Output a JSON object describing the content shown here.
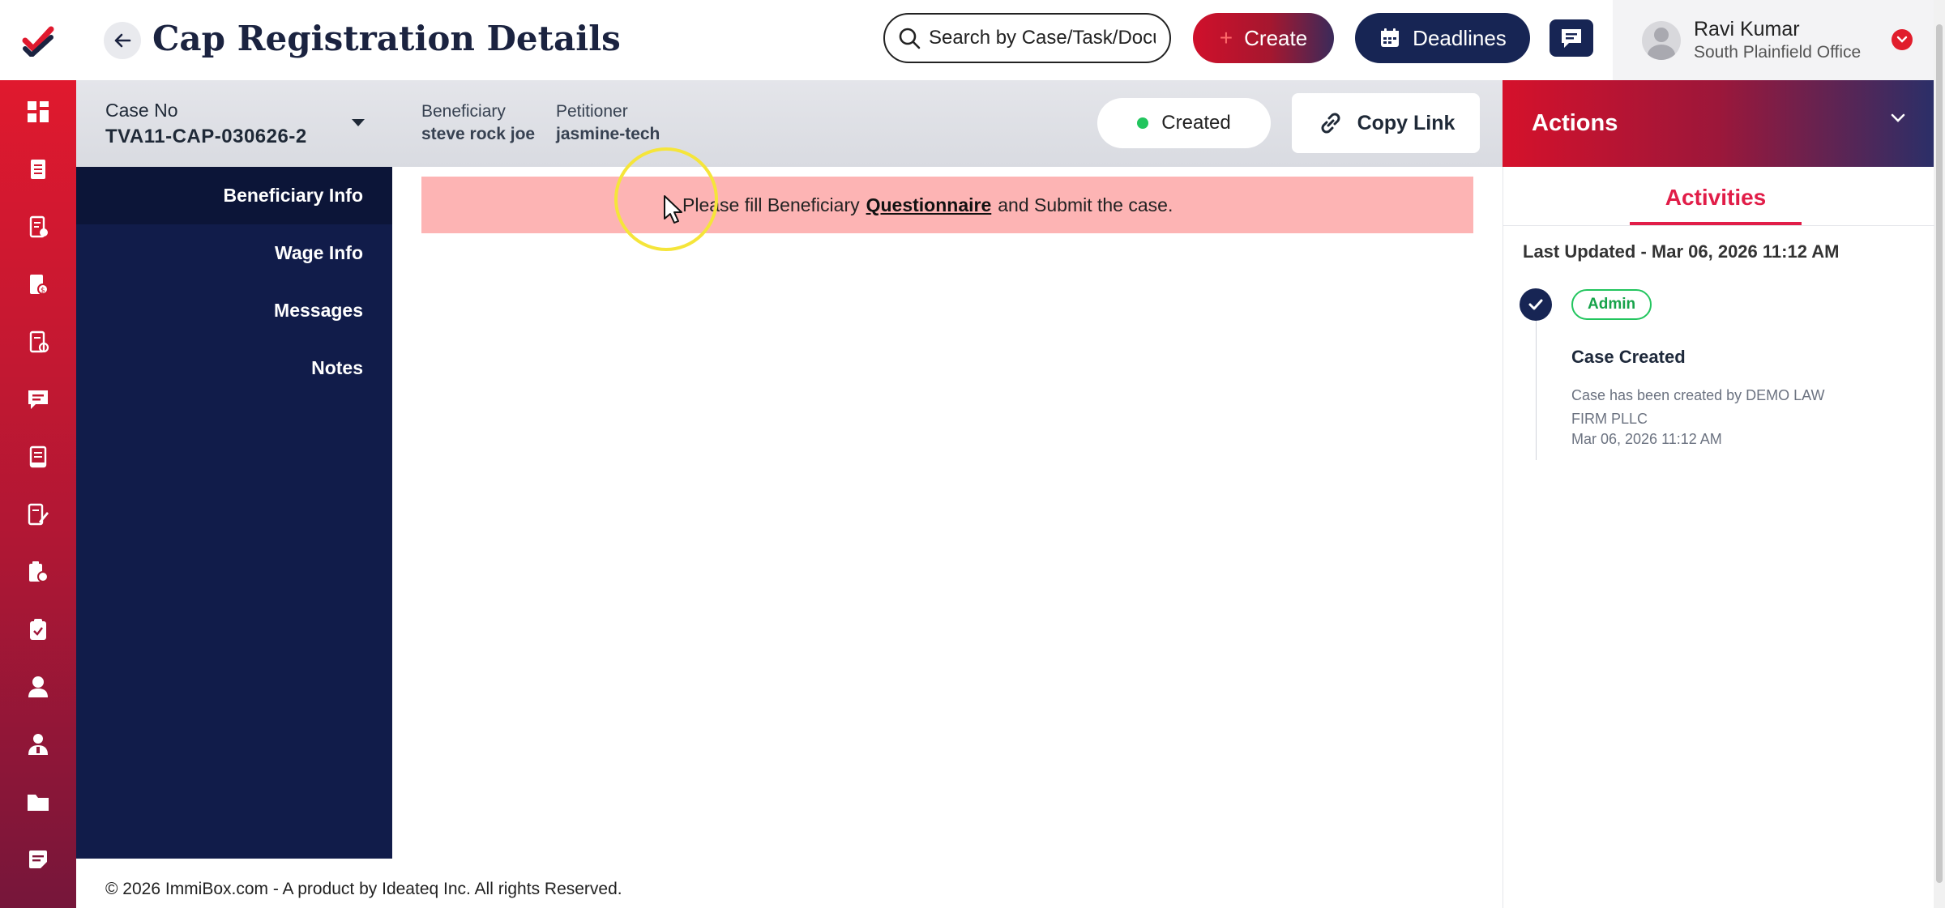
{
  "header": {
    "title": "Cap Registration Details",
    "search_placeholder": "Search by Case/Task/Document",
    "create_label": "Create",
    "deadlines_label": "Deadlines",
    "user_name": "Ravi Kumar",
    "user_office": "South Plainfield Office"
  },
  "case": {
    "case_no_label": "Case No",
    "case_no": "TVA11-CAP-030626-2",
    "beneficiary_label": "Beneficiary",
    "beneficiary": "steve rock joe",
    "petitioner_label": "Petitioner",
    "petitioner": "jasmine-tech",
    "status": "Created",
    "copy_link_label": "Copy Link"
  },
  "sub_nav": {
    "items": [
      {
        "label": "Beneficiary Info"
      },
      {
        "label": "Wage Info"
      },
      {
        "label": "Messages"
      },
      {
        "label": "Notes"
      }
    ]
  },
  "alert": {
    "prefix": "Please fill Beneficiary",
    "link": "Questionnaire",
    "suffix": "and Submit the case."
  },
  "actions": {
    "title": "Actions",
    "tab": "Activities",
    "last_updated": "Last Updated - Mar 06, 2026 11:12 AM",
    "items": [
      {
        "badge": "Admin",
        "title": "Case Created",
        "description": "Case has been created by DEMO LAW FIRM PLLC",
        "time": "Mar 06, 2026 11:12 AM"
      }
    ]
  },
  "footer": {
    "text": "© 2026 ImmiBox.com - A product by Ideateq Inc. All rights Reserved."
  },
  "colors": {
    "brand_red": "#e0192e",
    "navy": "#172554",
    "sub_nav_bg": "#111c4a",
    "alert_bg": "#fdb4b4",
    "status_green": "#22c55e"
  },
  "rail_icons": [
    "dashboard-icon",
    "cases-icon",
    "documents-check-icon",
    "invoice-icon",
    "forms-check-icon",
    "chat-icon",
    "reports-icon",
    "edit-notes-icon",
    "templates-icon",
    "tasks-icon",
    "user-icon",
    "contacts-icon",
    "folder-icon",
    "notes-icon"
  ]
}
